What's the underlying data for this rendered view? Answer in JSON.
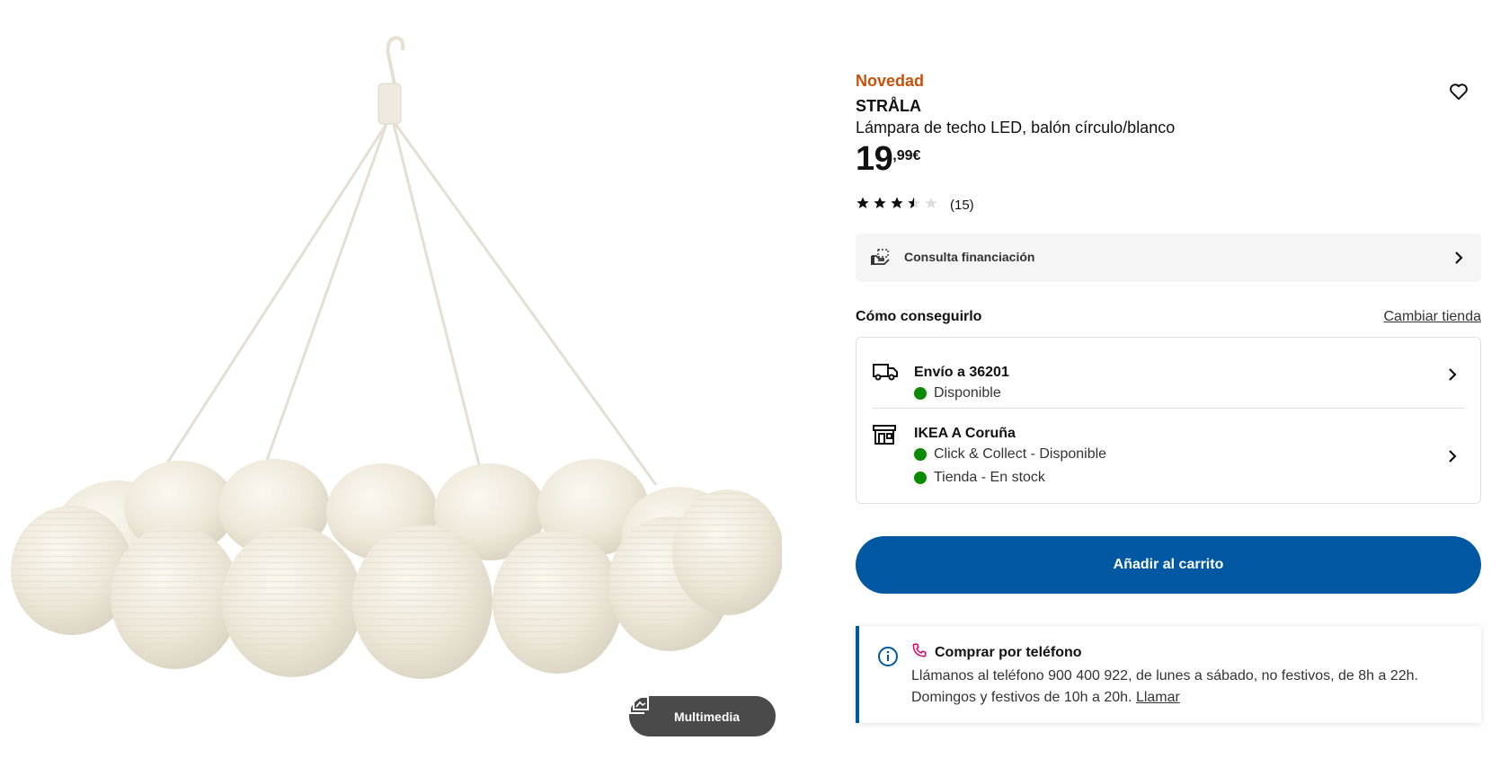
{
  "product": {
    "badge": "Novedad",
    "name": "STRÅLA",
    "description": "Lámpara de techo LED, balón círculo/blanco",
    "price_integer": "19",
    "price_decimal": ",99€",
    "rating_value": 3.5,
    "rating_max": 5,
    "rating_count": "(15)"
  },
  "media": {
    "multimedia_label": "Multimedia",
    "image_subject": "lamp-garland-of-white-paper-lanterns"
  },
  "financing": {
    "label": "Consulta financiación",
    "icon": "financing-icon"
  },
  "availability": {
    "title": "Cómo conseguirlo",
    "change_store_label": "Cambiar tienda",
    "delivery": {
      "title": "Envío a 36201",
      "status": "Disponible",
      "icon": "truck-icon"
    },
    "store": {
      "title": "IKEA A Coruña",
      "status_1": "Click & Collect - Disponible",
      "status_2": "Tienda - En stock",
      "icon": "store-icon"
    }
  },
  "cart": {
    "add_label": "Añadir al carrito"
  },
  "phone": {
    "title": "Comprar por teléfono",
    "text": "Llámanos al teléfono 900 400 922, de lunes a sábado, no festivos, de 8h a 22h. Domingos y festivos de 10h a 20h.",
    "link_label": "Llamar"
  },
  "colors": {
    "accent_blue": "#0058a3",
    "badge_orange": "#ca5008",
    "available_green": "#0a8a00"
  }
}
